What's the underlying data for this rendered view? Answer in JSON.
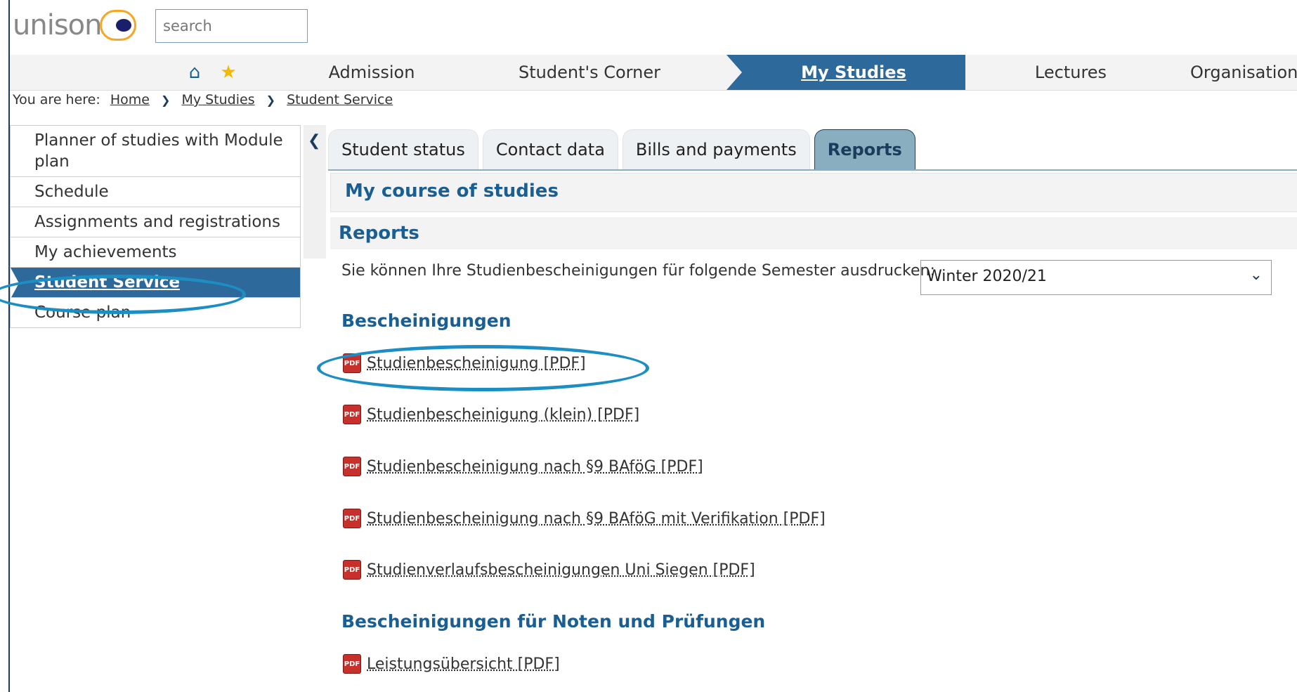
{
  "header": {
    "logo": "unison",
    "search_placeholder": "search"
  },
  "nav": {
    "items": [
      "Admission",
      "Student's Corner",
      "My Studies",
      "Lectures",
      "Organisation"
    ],
    "active": "My Studies"
  },
  "breadcrumb": {
    "prefix": "You are here:",
    "items": [
      "Home",
      "My Studies",
      "Student Service"
    ]
  },
  "sidebar": {
    "items": [
      "Planner of studies with Module plan",
      "Schedule",
      "Assignments and registrations",
      "My achievements",
      "Student Service",
      "Course plan"
    ],
    "active": "Student Service"
  },
  "tabs": {
    "items": [
      "Student status",
      "Contact data",
      "Bills and payments",
      "Reports"
    ],
    "active": "Reports"
  },
  "main": {
    "course_title": "My course of studies",
    "reports_title": "Reports",
    "semester_prompt": "Sie können Ihre Studienbescheinigungen für folgende Semester ausdrucken:",
    "semester_value": "Winter 2020/21",
    "certificates_heading": "Bescheinigungen",
    "certificates": [
      "Studienbescheinigung [PDF]",
      "Studienbescheinigung (klein) [PDF]",
      "Studienbescheinigung nach §9 BAföG [PDF]",
      "Studienbescheinigung nach §9 BAföG mit Verifikation [PDF]",
      "Studienverlaufsbescheinigungen Uni Siegen [PDF]"
    ],
    "grades_heading": "Bescheinigungen für Noten und Prüfungen",
    "grades": [
      "Leistungsübersicht [PDF]"
    ]
  },
  "colors": {
    "accent": "#2d6a9b",
    "heading": "#1b5e92",
    "annotation": "#1c8ec3",
    "logo_ring": "#f5a623"
  },
  "icons": {
    "home": "home-icon",
    "favorite": "star-icon",
    "pdf": "pdf-icon"
  }
}
